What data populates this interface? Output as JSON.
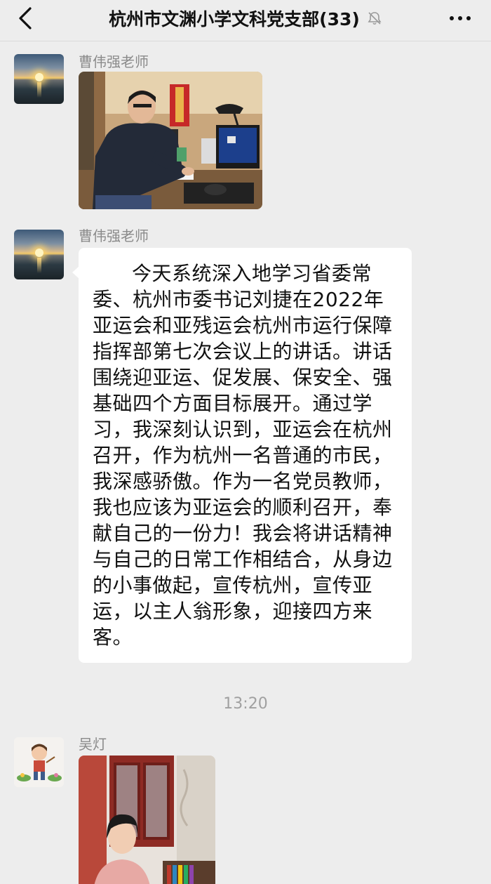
{
  "header": {
    "title": "杭州市文渊小学文科党支部(33)",
    "back_icon": "chevron-left-icon",
    "mute_icon": "bell-muted-icon",
    "more_icon": "more-dots-icon"
  },
  "messages": [
    {
      "sender": "曹伟强老师",
      "type": "image",
      "image": "man-at-desk-photo"
    },
    {
      "sender": "曹伟强老师",
      "type": "text",
      "text": "今天系统深入地学习省委常委、杭州市委书记刘捷在2022年亚运会和亚残运会杭州市运行保障指挥部第七次会议上的讲话。讲话围绕迎亚运、促发展、保安全、强基础四个方面目标展开。通过学习，我深刻认识到，亚运会在杭州召开，作为杭州一名普通的市民，我深感骄傲。作为一名党员教师，我也应该为亚运会的顺利召开，奉献自己的一份力！我会将讲话精神与自己的日常工作相结合，从身边的小事做起，宣传杭州，宣传亚运，以主人翁形象，迎接四方来客。"
    },
    {
      "sender": "吴灯",
      "type": "image",
      "image": "woman-in-room-photo"
    }
  ],
  "timestamp": "13:20",
  "colors": {
    "background": "#ededed",
    "bubble": "#ffffff",
    "name_text": "#8a8a8a",
    "time_text": "#a0a0a0"
  }
}
